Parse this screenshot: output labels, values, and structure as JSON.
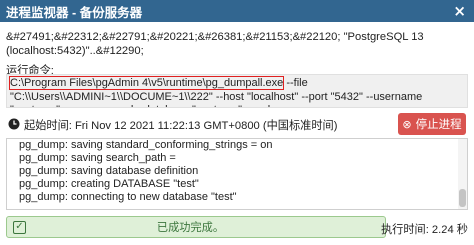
{
  "window": {
    "title": "进程监视器 - 备份服务器",
    "close_icon": "×"
  },
  "description": "&#27491;&#22312;&#22791;&#20221;&#26381;&#21153;&#22120; \"PostgreSQL 13 (localhost:5432)\"..&#12290;",
  "command": {
    "label": "运行命令:",
    "highlighted": "C:\\Program Files\\pgAdmin 4\\v5\\runtime\\pg_dumpall.exe",
    "rest": " --file \"C:\\\\Users\\\\ADMINI~1\\\\DOCUME~1\\\\222\" --host \"localhost\" --port \"5432\" --username \"postgres\" --no-password --database \"postgres\" --verbose"
  },
  "start_time": "起始时间: Fri Nov 12 2021 11:22:13 GMT+0800 (中国标准时间)",
  "stop_button": {
    "icon": "⊗",
    "label": "停止进程"
  },
  "log_lines": [
    "pg_dump: saving standard_conforming_strings = on",
    "pg_dump: saving search_path =",
    "pg_dump: saving database definition",
    "pg_dump: creating DATABASE \"test\"",
    "pg_dump: connecting to new database \"test\""
  ],
  "status": {
    "text": "已成功完成。",
    "icon": "check-icon"
  },
  "elapsed": "执行时间: 2.24 秒",
  "watermark": "CSDN @大小苏",
  "colors": {
    "titlebar": "#326690",
    "stop_button": "#d9534f",
    "success_bg": "#dff0d8",
    "highlight": "#e02020"
  }
}
